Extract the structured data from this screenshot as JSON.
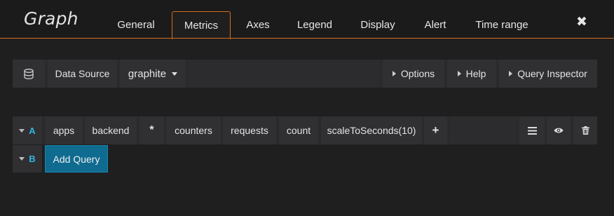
{
  "panel": {
    "title": "Graph"
  },
  "tabs": [
    {
      "label": "General"
    },
    {
      "label": "Metrics"
    },
    {
      "label": "Axes"
    },
    {
      "label": "Legend"
    },
    {
      "label": "Display"
    },
    {
      "label": "Alert"
    },
    {
      "label": "Time range"
    }
  ],
  "active_tab": "Metrics",
  "colors": {
    "accent": "#d46d1b",
    "query_letter": "#33b5e5",
    "add_query_bg": "#0f6b8f"
  },
  "datasource": {
    "icon": "database-icon",
    "label": "Data Source",
    "selected": "graphite",
    "options_label": "Options",
    "help_label": "Help",
    "inspector_label": "Query Inspector"
  },
  "queries": [
    {
      "letter": "A",
      "segments": [
        "apps",
        "backend",
        "*",
        "counters",
        "requests",
        "count"
      ],
      "function": "scaleToSeconds(10)",
      "add": "+"
    },
    {
      "letter": "B"
    }
  ],
  "add_query_label": "Add Query"
}
